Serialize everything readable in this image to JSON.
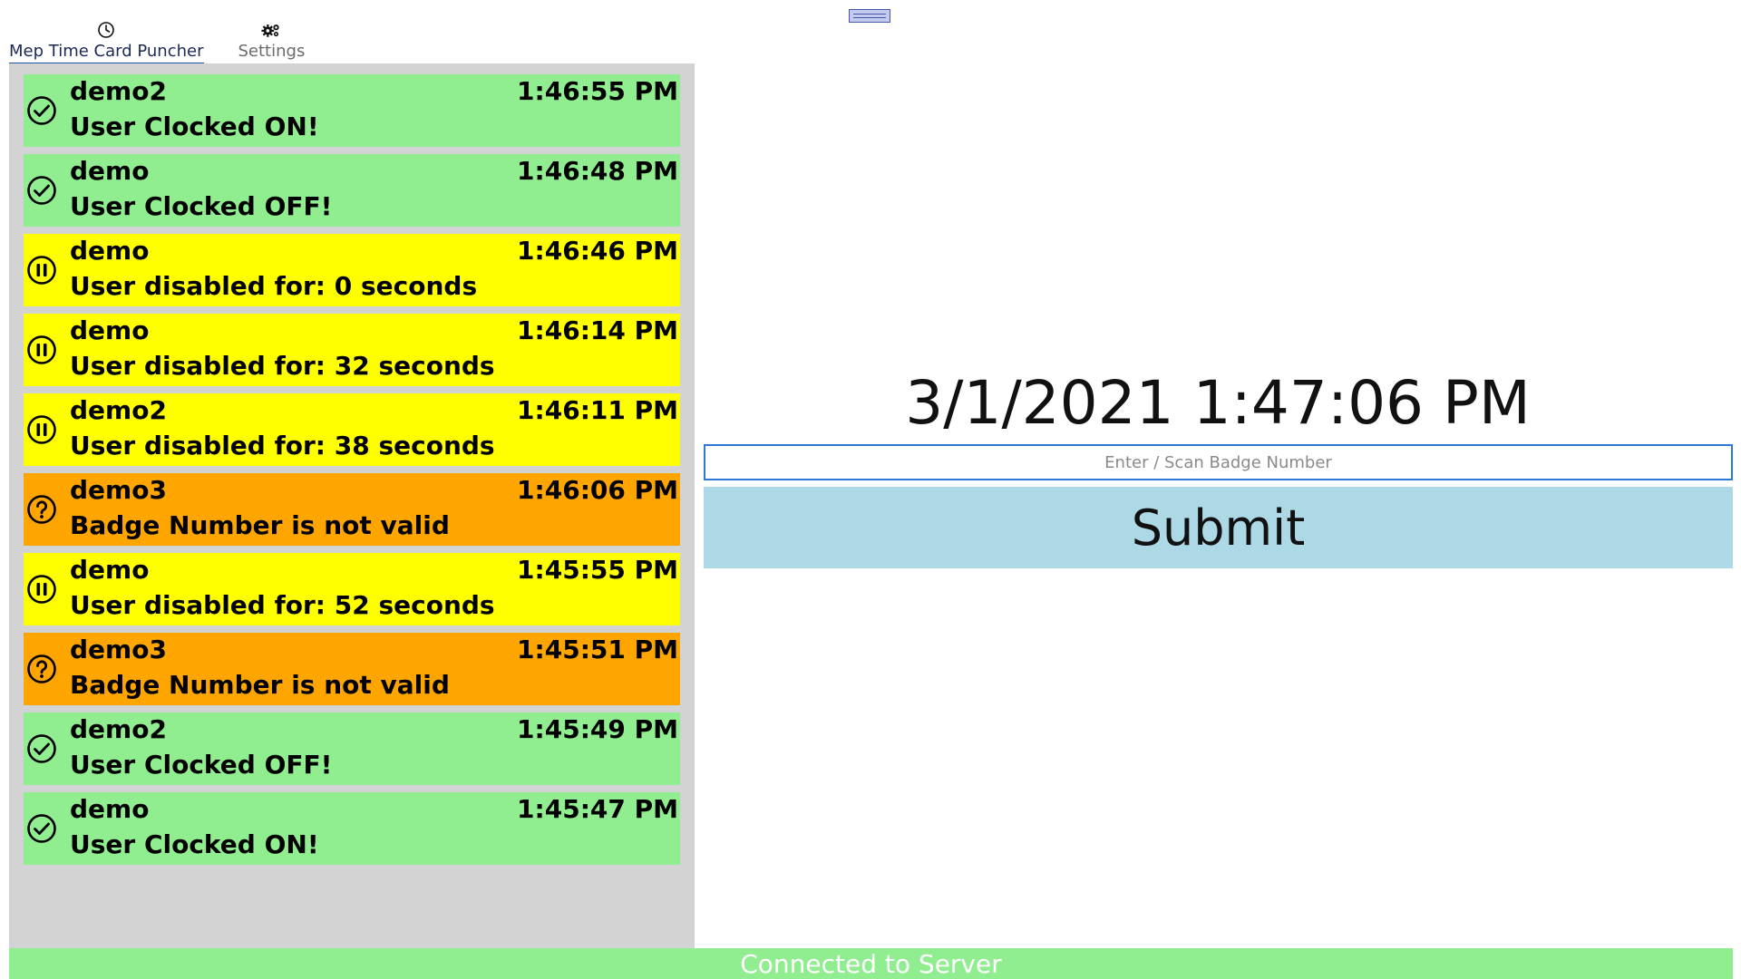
{
  "nav": {
    "tabs": [
      {
        "label": "Mep Time Card Puncher",
        "icon": "clock-icon",
        "active": true
      },
      {
        "label": "Settings",
        "icon": "gears-icon",
        "active": false
      }
    ]
  },
  "colors": {
    "success": "#90ee90",
    "warning": "#ffff00",
    "error": "#ffa500",
    "submit": "#add8e6",
    "status": "#90ee90"
  },
  "events": [
    {
      "user": "demo2",
      "time": "1:46:55 PM",
      "message": "User Clocked ON!",
      "status": "success",
      "icon": "check-circle-icon"
    },
    {
      "user": "demo",
      "time": "1:46:48 PM",
      "message": "User Clocked OFF!",
      "status": "success",
      "icon": "check-circle-icon"
    },
    {
      "user": "demo",
      "time": "1:46:46 PM",
      "message": "User disabled for: 0 seconds",
      "status": "warning",
      "icon": "pause-circle-icon"
    },
    {
      "user": "demo",
      "time": "1:46:14 PM",
      "message": "User disabled for: 32 seconds",
      "status": "warning",
      "icon": "pause-circle-icon"
    },
    {
      "user": "demo2",
      "time": "1:46:11 PM",
      "message": "User disabled for: 38 seconds",
      "status": "warning",
      "icon": "pause-circle-icon"
    },
    {
      "user": "demo3",
      "time": "1:46:06 PM",
      "message": "Badge Number is not valid",
      "status": "error",
      "icon": "question-circle-icon"
    },
    {
      "user": "demo",
      "time": "1:45:55 PM",
      "message": "User disabled for: 52 seconds",
      "status": "warning",
      "icon": "pause-circle-icon"
    },
    {
      "user": "demo3",
      "time": "1:45:51 PM",
      "message": "Badge Number is not valid",
      "status": "error",
      "icon": "question-circle-icon"
    },
    {
      "user": "demo2",
      "time": "1:45:49 PM",
      "message": "User Clocked OFF!",
      "status": "success",
      "icon": "check-circle-icon"
    },
    {
      "user": "demo",
      "time": "1:45:47 PM",
      "message": "User Clocked ON!",
      "status": "success",
      "icon": "check-circle-icon"
    }
  ],
  "clock": {
    "datetime": "3/1/2021 1:47:06 PM"
  },
  "badge": {
    "placeholder": "Enter / Scan Badge Number",
    "value": ""
  },
  "submit": {
    "label": "Submit"
  },
  "status_bar": {
    "text": "Connected to Server"
  }
}
